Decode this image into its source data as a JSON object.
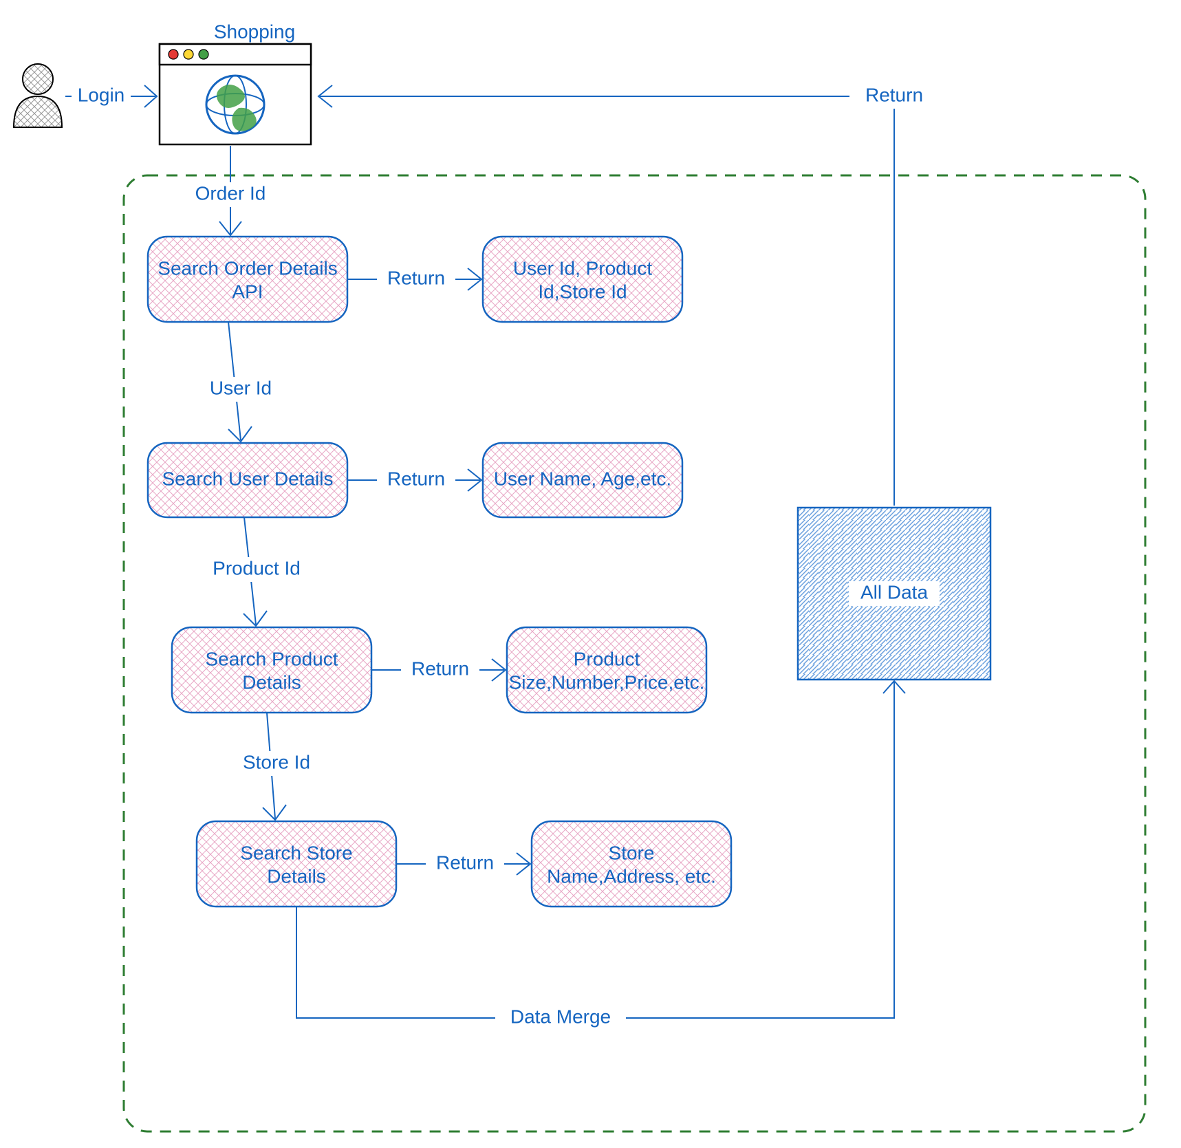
{
  "actor": {
    "label": ""
  },
  "browser": {
    "title": "Shopping"
  },
  "edges": {
    "login": "Login",
    "order_id": "Order Id",
    "return1": "Return",
    "user_id": "User Id",
    "return2": "Return",
    "product_id": "Product Id",
    "return3": "Return",
    "store_id": "Store Id",
    "return4": "Return",
    "data_merge": "Data Merge",
    "return_final": "Return"
  },
  "nodes": {
    "search_order": {
      "line1": "Search Order Details",
      "line2": "API"
    },
    "order_result": {
      "line1": "User Id, Product",
      "line2": "Id,Store Id"
    },
    "search_user": {
      "line1": "Search User Details"
    },
    "user_result": {
      "line1": "User Name, Age,etc."
    },
    "search_product": {
      "line1": "Search Product",
      "line2": "Details"
    },
    "product_result": {
      "line1": "Product",
      "line2": "Size,Number,Price,etc."
    },
    "search_store": {
      "line1": "Search Store",
      "line2": "Details"
    },
    "store_result": {
      "line1": "Store",
      "line2": "Name,Address, etc."
    },
    "all_data": {
      "line1": "All Data"
    }
  },
  "colors": {
    "stroke": "#1565c0",
    "pinkFill": "#f6d5e3",
    "dashGreen": "#2e7d32"
  }
}
